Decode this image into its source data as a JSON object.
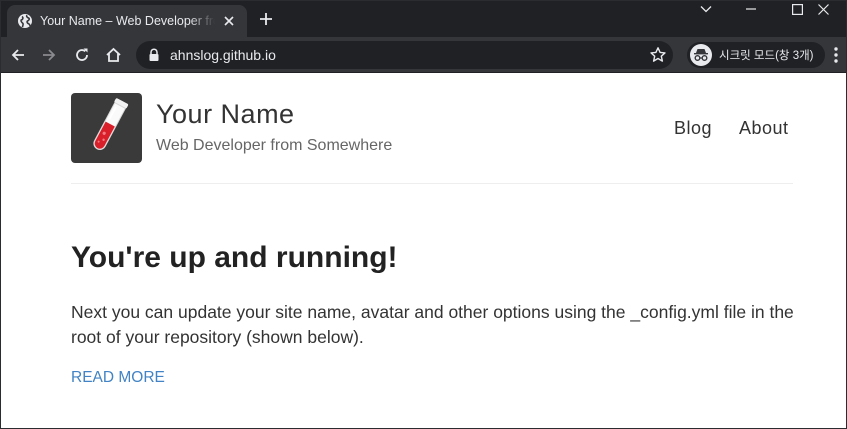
{
  "browser": {
    "tab": {
      "title": "Your Name – Web Developer from Somewhere"
    },
    "address": {
      "url": "ahnslog.github.io"
    },
    "incognito": {
      "label": "시크릿 모드(창 3개)"
    }
  },
  "site": {
    "title": "Your Name",
    "description": "Web Developer from Somewhere",
    "nav": [
      "Blog",
      "About"
    ]
  },
  "post": {
    "title": "You're up and running!",
    "body": "Next you can update your site name, avatar and other options using the _config.yml file in the root of your repository (shown below).",
    "read_more": "READ MORE"
  },
  "colors": {
    "tabbar": "#202124",
    "toolbar": "#35363a",
    "link": "#4183c4",
    "avatar_bg": "#3a3a3a"
  }
}
